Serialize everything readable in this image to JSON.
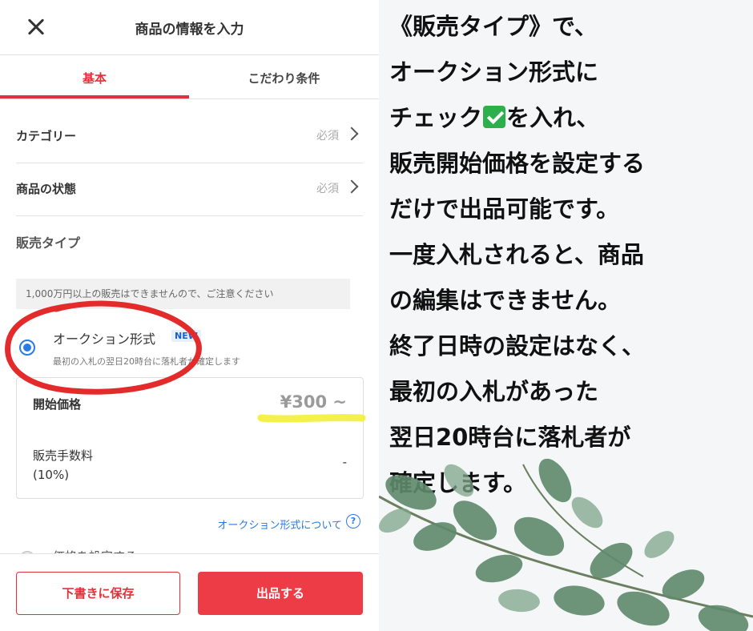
{
  "header": {
    "title": "商品の情報を入力",
    "close_icon": "close-icon"
  },
  "tabs": [
    {
      "label": "基本",
      "active": true
    },
    {
      "label": "こだわり条件",
      "active": false
    }
  ],
  "rows": [
    {
      "label": "カテゴリー",
      "required": "必須"
    },
    {
      "label": "商品の状態",
      "required": "必須"
    }
  ],
  "sale_type": {
    "title": "販売タイプ",
    "notice": "1,000万円以上の販売はできませんので、ご注意ください",
    "auction_option": {
      "label": "オークション形式",
      "badge": "NEW",
      "description": "最初の入札の翌日20時台に落札者が確定します",
      "selected": true
    },
    "start_price": {
      "label": "開始価格",
      "value": "¥300 ~"
    },
    "fee": {
      "label_line1": "販売手数料",
      "label_line2": "(10%)",
      "value": "-"
    },
    "about_link": "オークション形式について",
    "next_option_partial": "価格を設定する"
  },
  "actions": {
    "draft": "下書きに保存",
    "submit": "出品する"
  },
  "explanation": {
    "line1": "《販売タイプ》で、",
    "line2": "オークション形式に",
    "line3_before": "チェック",
    "line3_after": "を入れ、",
    "line4": "販売開始価格を設定する",
    "line5": "だけで出品可能です。",
    "line6": "一度入札されると、商品",
    "line7": "の編集はできません。",
    "line8": "終了日時の設定はなく、",
    "line9": "最初の入札があった",
    "line10": "翌日20時台に落札者が",
    "line11": "確定します。"
  },
  "colors": {
    "accent": "#e0323a",
    "link": "#2a7be4",
    "annotation_circle": "#e32b2b",
    "highlight": "#f2ee2a"
  }
}
